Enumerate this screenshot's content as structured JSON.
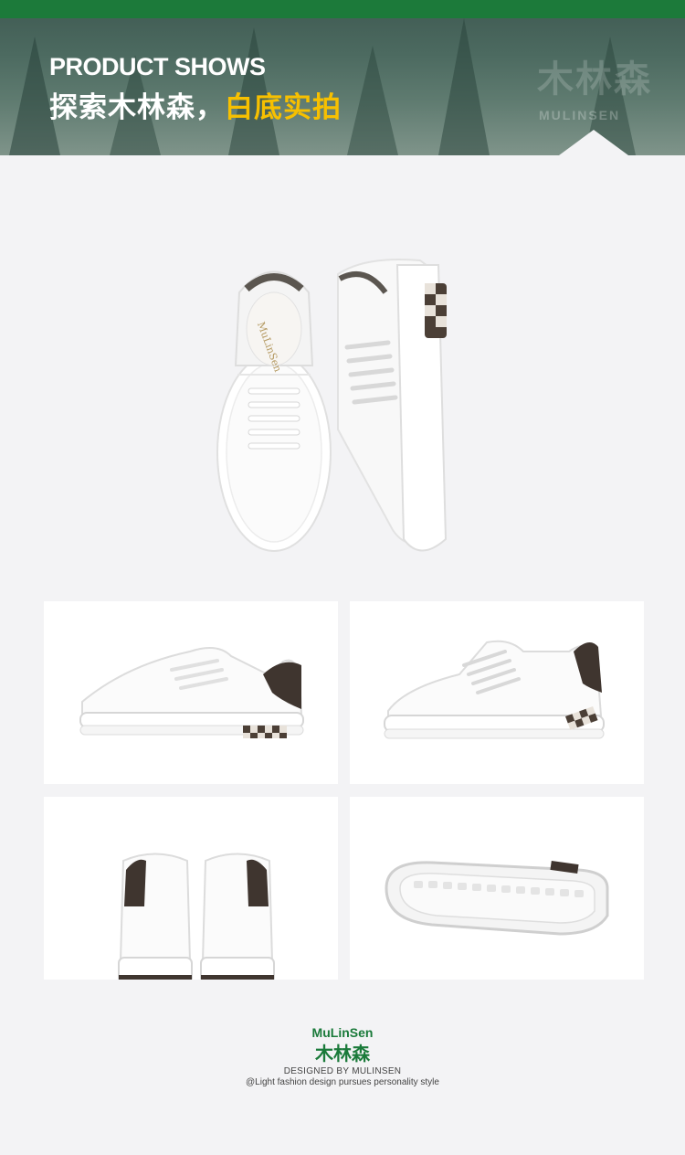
{
  "header": {
    "title_en": "PRODUCT SHOWS",
    "title_cn_plain": "探索木林森，",
    "title_cn_highlight": "白底实拍",
    "watermark_cn": "木林森",
    "watermark_en": "MULINSEN"
  },
  "footer": {
    "brand_en": "MuLinSen",
    "brand_cn": "木林森",
    "tagline_1": "DESIGNED BY MULINSEN",
    "tagline_2": "@Light fashion design pursues personality style"
  },
  "colors": {
    "brand_green": "#1a7a3a",
    "highlight_yellow": "#f7c000",
    "header_bg": "#4c6a60"
  }
}
